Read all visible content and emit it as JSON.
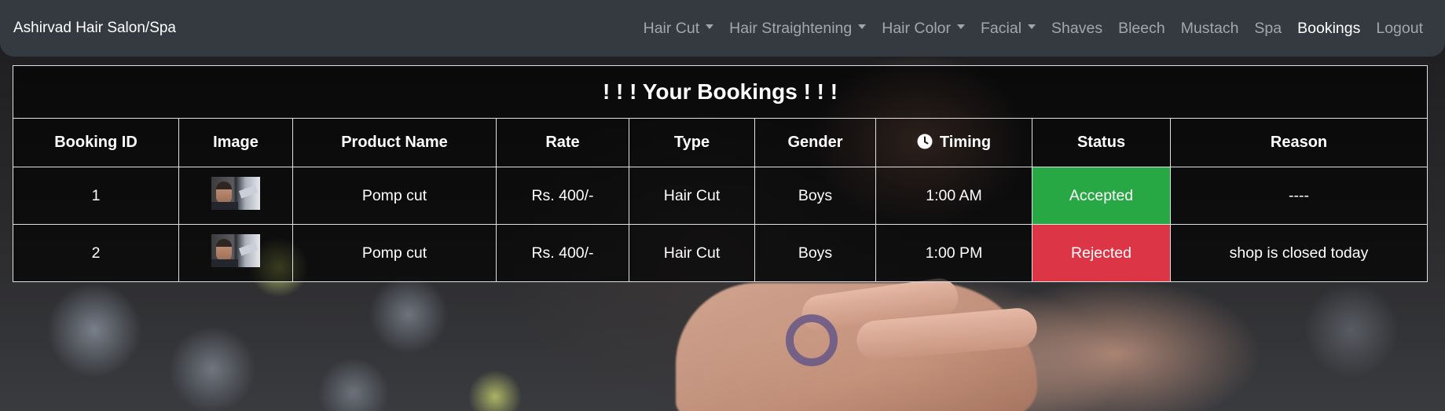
{
  "navbar": {
    "brand": "Ashirvad Hair Salon/Spa",
    "items": [
      {
        "label": "Hair Cut",
        "dropdown": true
      },
      {
        "label": "Hair Straightening",
        "dropdown": true
      },
      {
        "label": "Hair Color",
        "dropdown": true
      },
      {
        "label": "Facial",
        "dropdown": true
      },
      {
        "label": "Shaves",
        "dropdown": false
      },
      {
        "label": "Bleech",
        "dropdown": false
      },
      {
        "label": "Mustach",
        "dropdown": false
      },
      {
        "label": "Spa",
        "dropdown": false
      },
      {
        "label": "Bookings",
        "dropdown": false,
        "active": true
      },
      {
        "label": "Logout",
        "dropdown": false
      }
    ]
  },
  "bookings": {
    "title": "! ! ! Your Bookings ! ! !",
    "columns": {
      "id": "Booking ID",
      "image": "Image",
      "product": "Product Name",
      "rate": "Rate",
      "type": "Type",
      "gender": "Gender",
      "timing": "Timing",
      "status": "Status",
      "reason": "Reason"
    },
    "rows": [
      {
        "id": "1",
        "product": "Pomp cut",
        "rate": "Rs. 400/-",
        "type": "Hair Cut",
        "gender": "Boys",
        "timing": "1:00 AM",
        "status": "Accepted",
        "reason": "----"
      },
      {
        "id": "2",
        "product": "Pomp cut",
        "rate": "Rs. 400/-",
        "type": "Hair Cut",
        "gender": "Boys",
        "timing": "1:00 PM",
        "status": "Rejected",
        "reason": "shop is closed today"
      }
    ]
  },
  "colors": {
    "navbar_bg": "#343a40",
    "accepted": "#28a745",
    "rejected": "#dc3545"
  },
  "icons": {
    "timing": "clock-icon",
    "dropdown": "caret-down-icon"
  }
}
